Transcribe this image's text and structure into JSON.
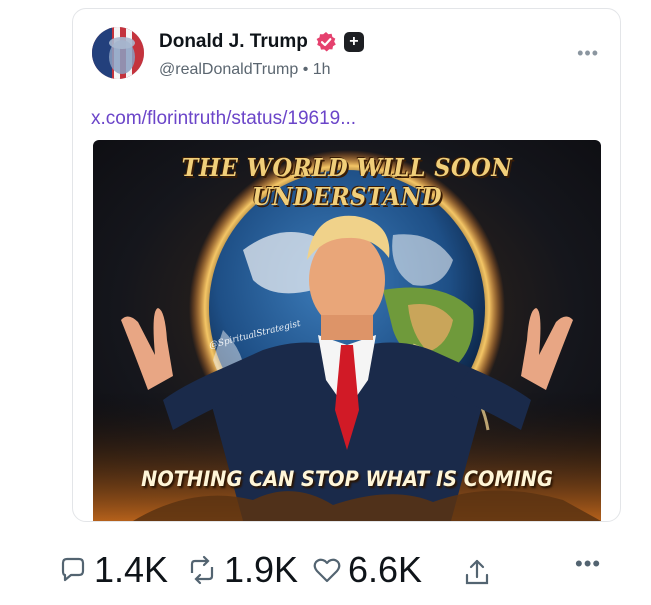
{
  "post": {
    "author_name": "Donald J. Trump",
    "handle": "@realDonaldTrump",
    "separator": "•",
    "time": "1h",
    "link_text": "x.com/florintruth/status/19619...",
    "image": {
      "headline": "THE WORLD WILL SOON UNDERSTAND",
      "footer": "NOTHING CAN STOP WHAT IS COMING",
      "signature": "@SpiritualStrategist"
    }
  },
  "actions": {
    "replies": "1.4K",
    "reposts": "1.9K",
    "likes": "6.6K"
  },
  "icons": {
    "verified": "verified-badge-icon",
    "plus": "plus-badge-icon",
    "more": "more-horizontal-icon",
    "reply": "reply-icon",
    "repost": "repost-icon",
    "like": "heart-icon",
    "share": "share-icon"
  },
  "colors": {
    "verified": "#e5416e",
    "link": "#6b45c9",
    "text": "#0f1419",
    "muted": "#5b6670"
  }
}
